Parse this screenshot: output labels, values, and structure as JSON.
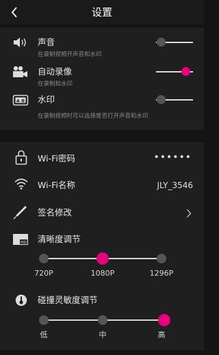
{
  "header": {
    "back_icon": "chevron-left-icon",
    "title": "设置"
  },
  "colors": {
    "accent": "#e6007e",
    "knob_off": "#555555",
    "background": "#141414",
    "section_bg": "#1f1f1f"
  },
  "recording": {
    "sound": {
      "icon": "speaker-icon",
      "label": "声音",
      "desc": "在录制视频开声音和水印",
      "enabled": false
    },
    "auto_record": {
      "icon": "video-camera-icon",
      "label": "自动录像",
      "desc": "在录制和水印",
      "enabled": true
    },
    "watermark": {
      "icon": "watermark-icon",
      "label": "水印",
      "desc": "在录制视频时可以选择是否打开声音和水印",
      "enabled": false
    }
  },
  "device": {
    "wifi_password": {
      "icon": "lock-icon",
      "label": "Wi-Fi密码",
      "value": "••••••"
    },
    "wifi_name": {
      "icon": "wifi-icon",
      "label": "Wi-Fi名称",
      "value": "JLY_3546"
    },
    "signature": {
      "icon": "pen-icon",
      "label": "签名修改",
      "chevron_icon": "chevron-right-icon"
    },
    "resolution": {
      "icon": "hd-icon",
      "label": "清晰度调节",
      "options": [
        "720P",
        "1080P",
        "1296P"
      ],
      "selected": 1
    },
    "sensitivity": {
      "icon": "thermometer-icon",
      "label": "碰撞灵敏度调节",
      "options": [
        "低",
        "中",
        "高"
      ],
      "selected": 2
    }
  }
}
